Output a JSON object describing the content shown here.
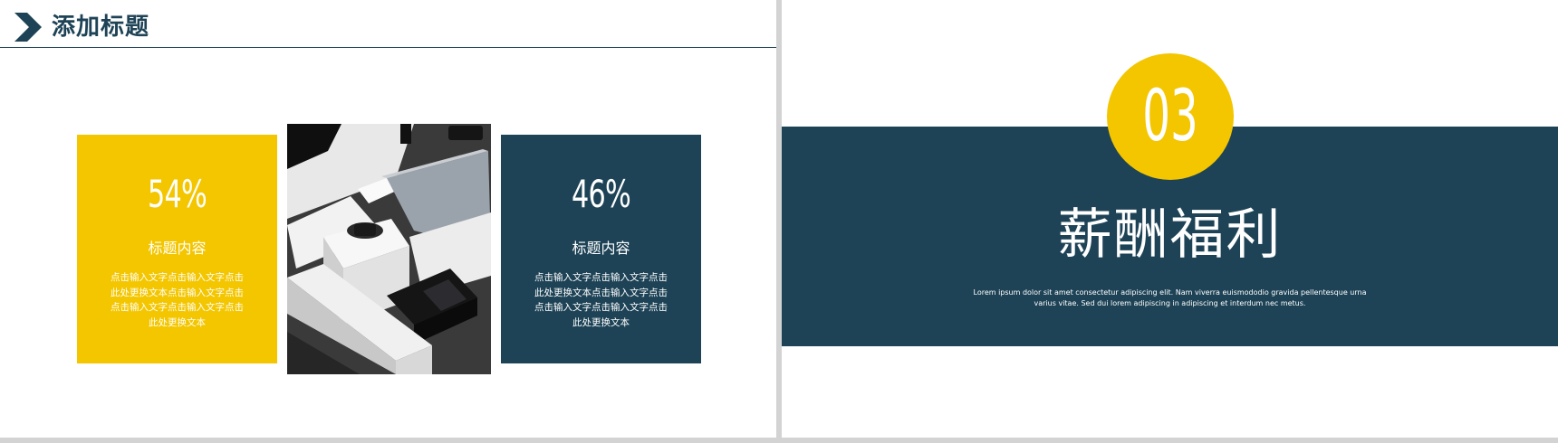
{
  "slide_left": {
    "header": {
      "title": "添加标题"
    },
    "cards": [
      {
        "value": "54%",
        "title": "标题内容",
        "body": "点击输入文字点击输入文字点击此处更换文本点击输入文字点击点击输入文字点击输入文字点击此处更换文本"
      },
      {
        "value": "46%",
        "title": "标题内容",
        "body": "点击输入文字点击输入文字点击此处更换文本点击输入文字点击点击输入文字点击输入文字点击此处更换文本"
      }
    ]
  },
  "slide_right": {
    "section_number": "03",
    "title": "薪酬福利",
    "subtitle": "Lorem ipsum dolor sit amet consectetur adipiscing elit. Nam viverra euismododio gravida pellentesque urna varius vitae. Sed dui lorem adipiscing in adipiscing et interdum nec metus."
  },
  "colors": {
    "accent_yellow": "#f3c600",
    "navy": "#1e4356",
    "background": "#ffffff",
    "divider": "#d3d3d3"
  }
}
